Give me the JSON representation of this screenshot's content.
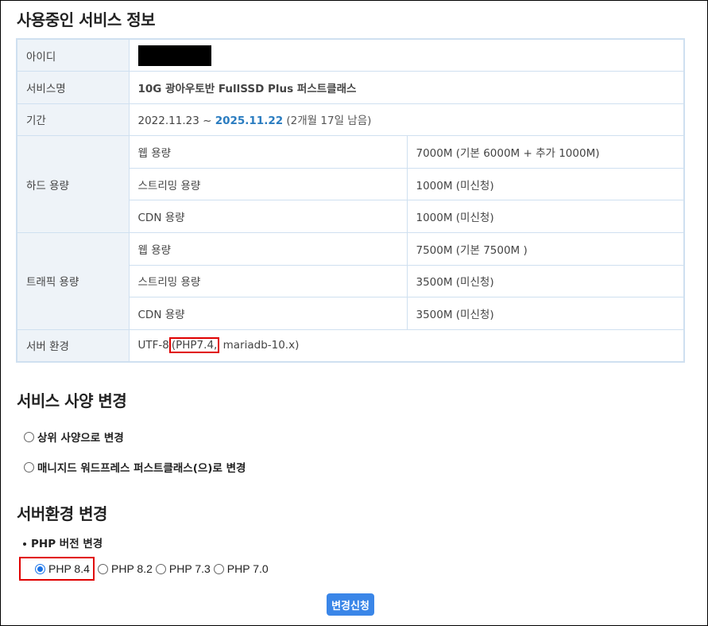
{
  "sections": {
    "current_service_title": "사용중인 서비스 정보",
    "spec_change_title": "서비스 사양 변경",
    "server_env_title": "서버환경 변경"
  },
  "info": {
    "id_label": "아이디",
    "service_name_label": "서비스명",
    "service_name": "10G 광아우토반 FullSSD Plus 퍼스트클래스",
    "period_label": "기간",
    "period_start": "2022.11.23 ~",
    "period_end": "2025.11.22",
    "period_remaining": "(2개월 17일 남음)",
    "disk_label": "하드 용량",
    "disk": [
      {
        "name": "웹 용량",
        "value": "7000M (기본 6000M + 추가 1000M)"
      },
      {
        "name": "스트리밍 용량",
        "value": "1000M (미신청)"
      },
      {
        "name": "CDN 용량",
        "value": "1000M (미신청)"
      }
    ],
    "traffic_label": "트래픽 용량",
    "traffic": [
      {
        "name": "웹 용량",
        "value": "7500M (기본 7500M )"
      },
      {
        "name": "스트리밍 용량",
        "value": "3500M (미신청)"
      },
      {
        "name": "CDN 용량",
        "value": "3500M (미신청)"
      }
    ],
    "server_env_label": "서버 환경",
    "server_env_prefix": "UTF-8",
    "server_env_php": "(PHP7.4,",
    "server_env_db": "mariadb-10.x)"
  },
  "spec_options": [
    {
      "label": "상위 사양으로 변경",
      "selected": false
    },
    {
      "label": "매니지드 워드프레스 퍼스트클래스(으)로 변경",
      "selected": false
    }
  ],
  "php": {
    "label": "PHP 버전 변경",
    "options": [
      {
        "label": "PHP 8.4",
        "selected": true
      },
      {
        "label": "PHP 8.2",
        "selected": false
      },
      {
        "label": "PHP 7.3",
        "selected": false
      },
      {
        "label": "PHP 7.0",
        "selected": false
      }
    ]
  },
  "submit_label": "변경신청",
  "colors": {
    "accent": "#2a7cc0",
    "button": "#3a86e8",
    "highlight": "#e00000"
  }
}
